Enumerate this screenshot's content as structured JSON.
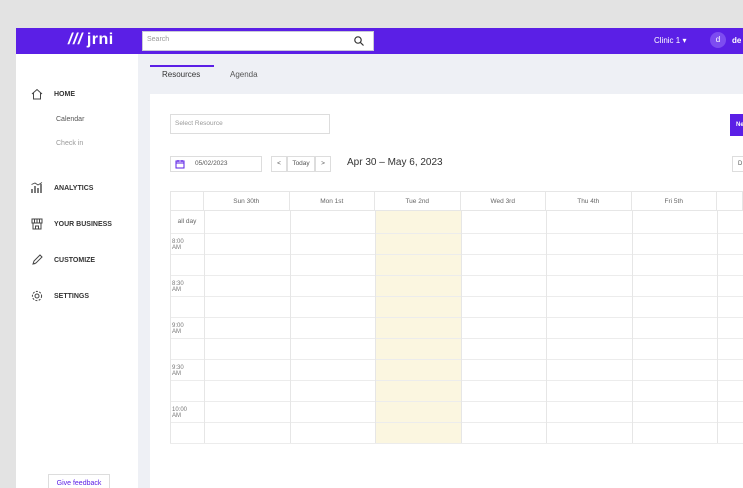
{
  "topbar": {
    "logo": "jrni",
    "search_placeholder": "Search",
    "clinic": "Clinic 1",
    "avatar_letter": "d",
    "user_name": "de"
  },
  "sidebar": {
    "home": "HOME",
    "calendar": "Calendar",
    "checkin": "Check in",
    "analytics": "ANALYTICS",
    "your_business": "YOUR BUSINESS",
    "customize": "CUSTOMIZE",
    "settings": "SETTINGS",
    "feedback": "Give feedback"
  },
  "tabs": [
    {
      "label": "Resources",
      "active": true
    },
    {
      "label": "Agenda",
      "active": false
    }
  ],
  "toolbar": {
    "select_resource_placeholder": "Select Resource",
    "new_button": "Ne",
    "date_value": "05/02/2023",
    "prev": "<",
    "today": "Today",
    "next": ">",
    "range_title": "Apr 30 – May 6, 2023",
    "view_button": "D"
  },
  "calendar": {
    "days": [
      "Sun 30th",
      "Mon 1st",
      "Tue 2nd",
      "Wed 3rd",
      "Thu 4th",
      "Fri 5th",
      ""
    ],
    "today_index": 2,
    "allday_label": "all day",
    "times": [
      "8:00 AM",
      "8:30 AM",
      "9:00 AM",
      "9:30 AM",
      "10:00 AM"
    ]
  },
  "colors": {
    "brand": "#5b1fe6",
    "today_highlight": "#fbf6e0"
  }
}
